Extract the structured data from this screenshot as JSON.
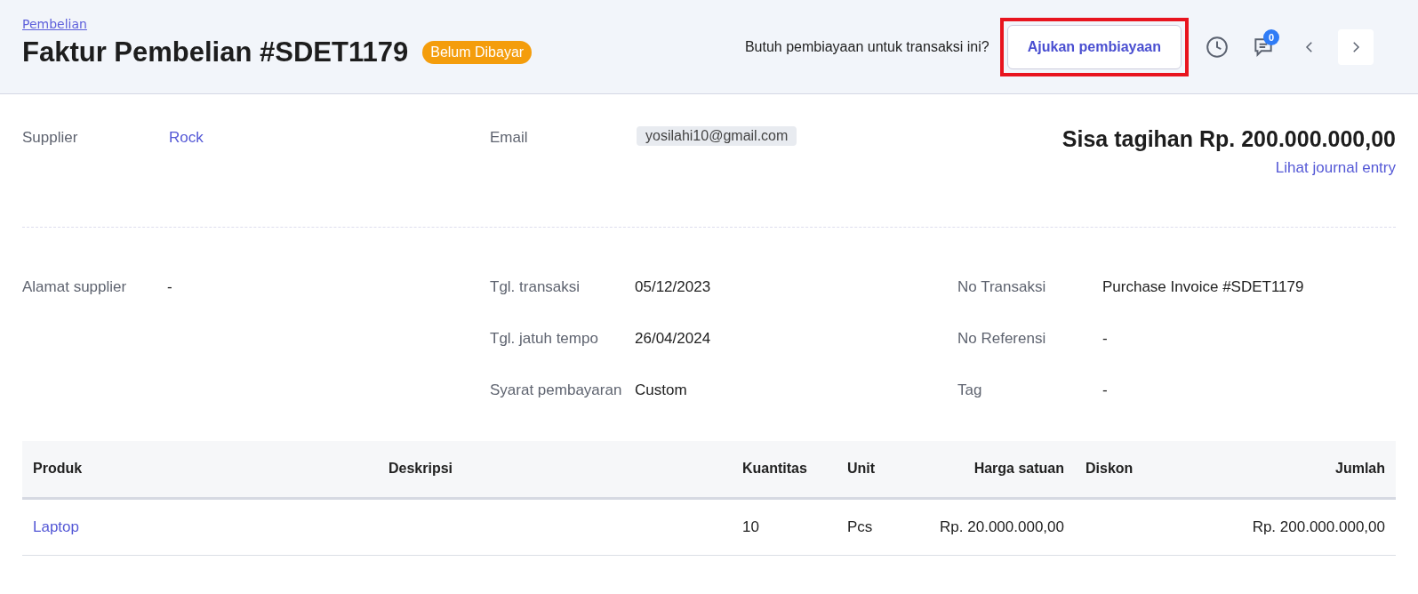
{
  "breadcrumb": "Pembelian",
  "title": "Faktur Pembelian #SDET1179",
  "status_badge": "Belum Dibayar",
  "financing_prompt": "Butuh pembiayaan untuk transaksi ini?",
  "financing_button": {
    "label": "Ajukan pembiayaan",
    "highlighted": true
  },
  "comment_count": "0",
  "summary": {
    "supplier_label": "Supplier",
    "supplier": "Rock",
    "email_label": "Email",
    "email": "yosilahi10@gmail.com",
    "balance": "Sisa tagihan Rp. 200.000.000,00",
    "journal_link": "Lihat journal entry"
  },
  "details": [
    [
      {
        "label": "Alamat supplier",
        "value": "-"
      }
    ],
    [
      {
        "label": "Tgl. transaksi",
        "value": "05/12/2023"
      },
      {
        "label": "Tgl. jatuh tempo",
        "value": "26/04/2024"
      },
      {
        "label": "Syarat pembayaran",
        "value": "Custom"
      }
    ],
    [
      {
        "label": "No Transaksi",
        "value": "Purchase Invoice #SDET1179"
      },
      {
        "label": "No Referensi",
        "value": "-"
      },
      {
        "label": "Tag",
        "value": "-"
      }
    ]
  ],
  "table": {
    "columns": [
      "Produk",
      "Deskripsi",
      "Kuantitas",
      "Unit",
      "Harga satuan",
      "Diskon",
      "Jumlah"
    ],
    "rows": [
      {
        "kind": "product",
        "cells": [
          "Laptop",
          "",
          "10",
          "Pcs",
          "Rp. 20.000.000,00",
          "",
          "Rp. 200.000.000,00"
        ]
      }
    ]
  }
}
